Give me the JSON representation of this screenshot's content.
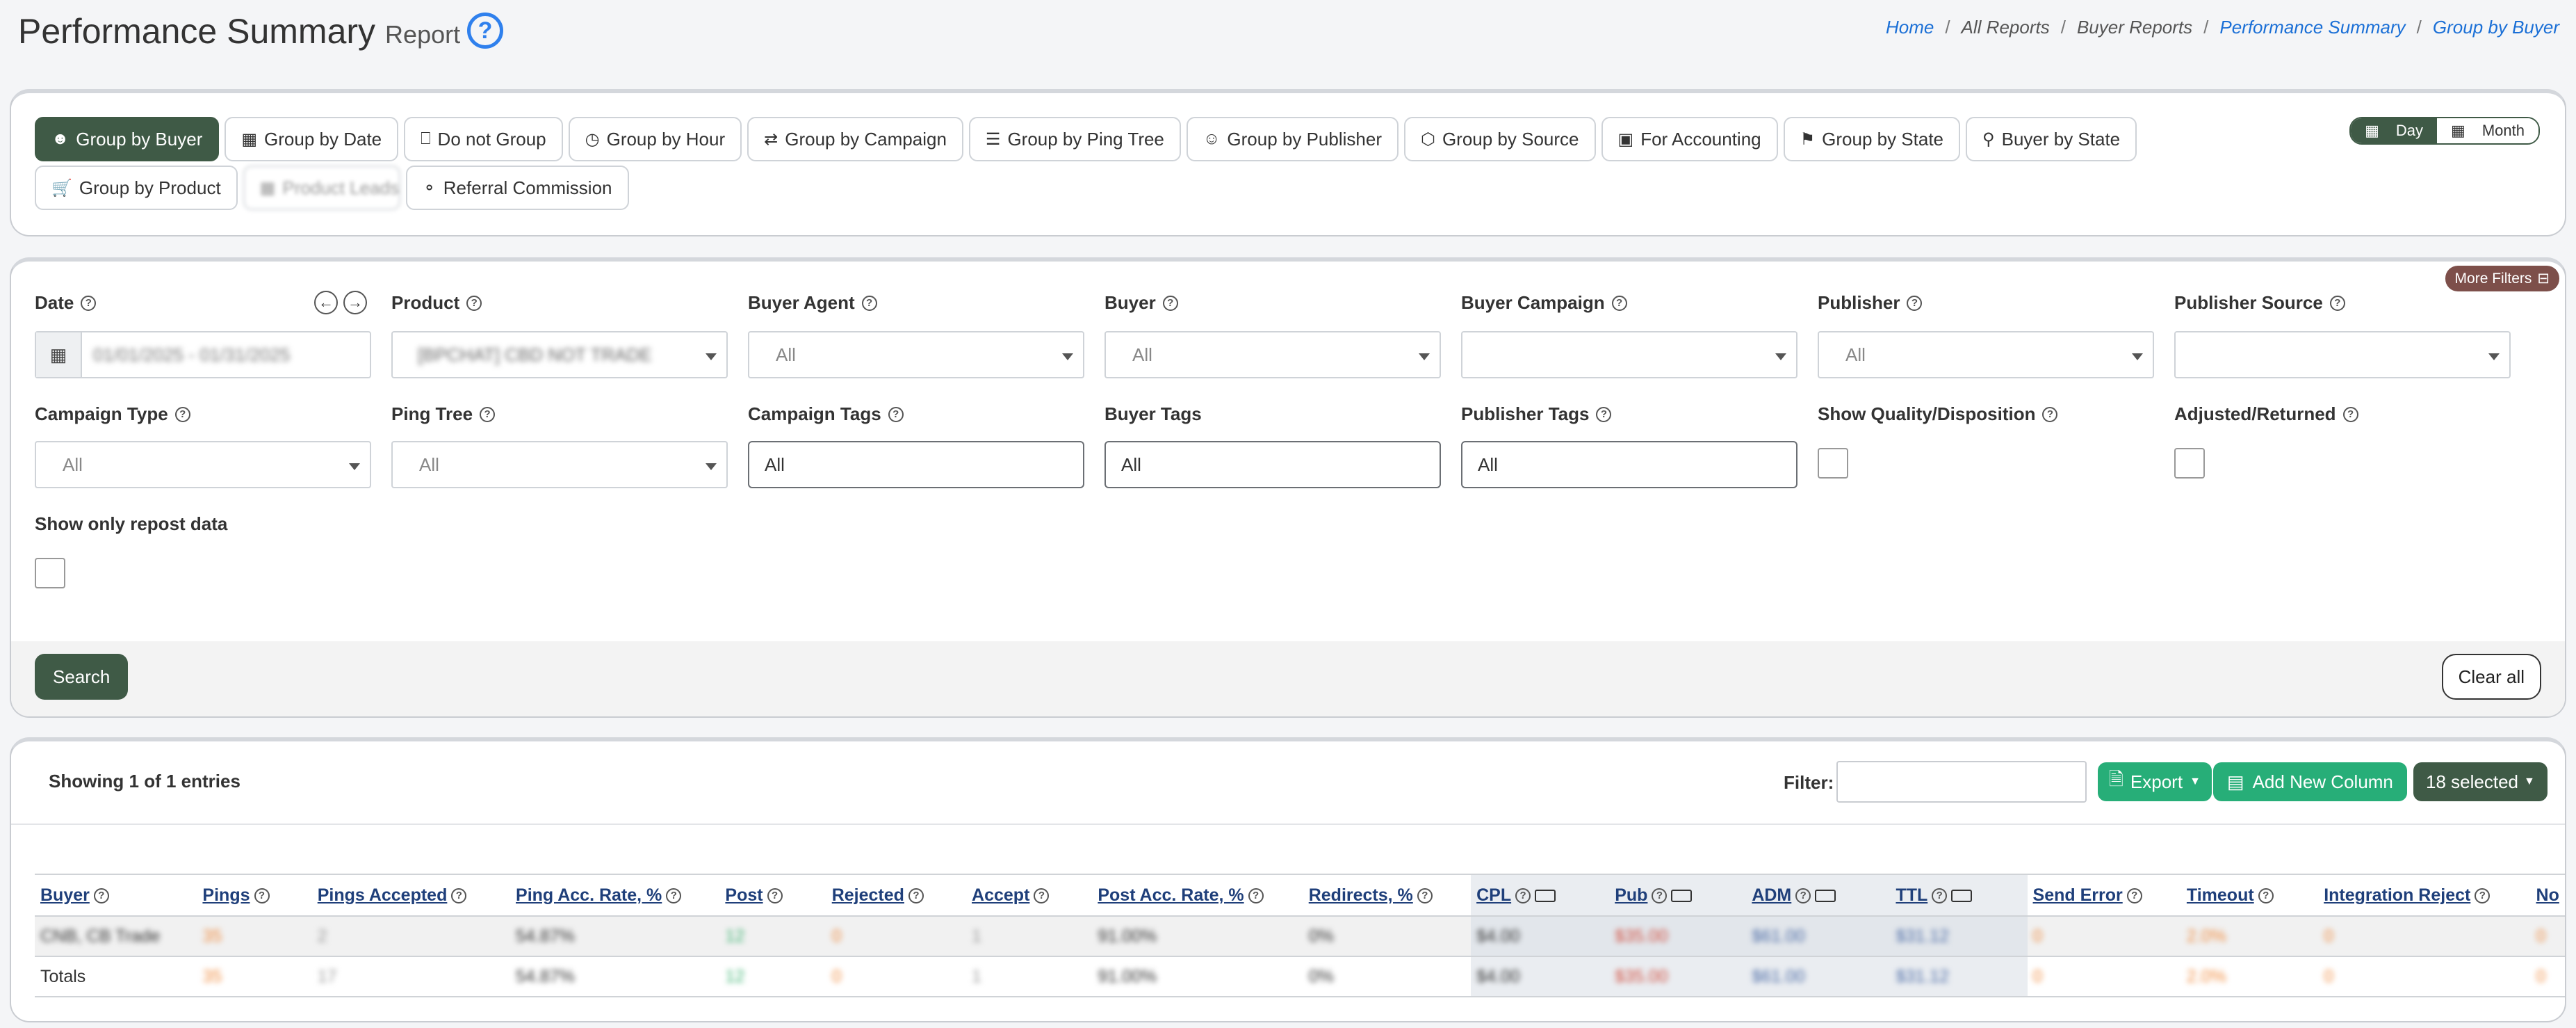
{
  "header": {
    "title": "Performance Summary",
    "subtitle": "Report",
    "help_icon": "question-circle-icon",
    "breadcrumb": [
      "Home",
      "All Reports",
      "Buyer Reports",
      "Performance Summary",
      "Group by Buyer"
    ]
  },
  "group_buttons": {
    "row1": [
      {
        "label": "Group by Buyer",
        "icon": "user-icon",
        "active": true
      },
      {
        "label": "Group by Date",
        "icon": "calendar-icon"
      },
      {
        "label": "Do not Group",
        "icon": "monitor-icon"
      },
      {
        "label": "Group by Hour",
        "icon": "clock-icon"
      },
      {
        "label": "Group by Campaign",
        "icon": "shuffle-icon"
      },
      {
        "label": "Group by Ping Tree",
        "icon": "list-icon"
      },
      {
        "label": "Group by Publisher",
        "icon": "users-icon"
      },
      {
        "label": "Group by Source",
        "icon": "box-icon"
      },
      {
        "label": "For Accounting",
        "icon": "credit-card-icon"
      },
      {
        "label": "Group by State",
        "icon": "signpost-icon"
      },
      {
        "label": "Buyer by State",
        "icon": "pin-icon"
      }
    ],
    "row2": [
      {
        "label": "Group by Product",
        "icon": "cart-icon"
      },
      {
        "label": "Product Leads",
        "icon": "grid-icon",
        "blurred": true
      },
      {
        "label": "Referral Commission",
        "icon": "piggy-bank-icon"
      }
    ],
    "period": {
      "day": "Day",
      "month": "Month",
      "selected": "Day"
    }
  },
  "filters": {
    "more_filters": "More Filters",
    "date": {
      "label": "Date",
      "value": "01/01/2025 - 01/31/2025"
    },
    "product": {
      "label": "Product",
      "value": "[BPCHAT] CBD NOT TRADE"
    },
    "buyer_agent": {
      "label": "Buyer Agent",
      "placeholder": "All"
    },
    "buyer": {
      "label": "Buyer",
      "placeholder": "All"
    },
    "buyer_campaign": {
      "label": "Buyer Campaign",
      "placeholder": ""
    },
    "publisher": {
      "label": "Publisher",
      "placeholder": "All"
    },
    "publisher_source": {
      "label": "Publisher Source",
      "placeholder": ""
    },
    "campaign_type": {
      "label": "Campaign Type",
      "placeholder": "All"
    },
    "ping_tree": {
      "label": "Ping Tree",
      "placeholder": "All"
    },
    "campaign_tags": {
      "label": "Campaign Tags",
      "value": "All"
    },
    "buyer_tags": {
      "label": "Buyer Tags",
      "value": "All"
    },
    "publisher_tags": {
      "label": "Publisher Tags",
      "value": "All"
    },
    "show_quality": {
      "label": "Show Quality/Disposition",
      "checked": false
    },
    "adjusted_returned": {
      "label": "Adjusted/Returned",
      "checked": false
    },
    "repost_only": {
      "label": "Show only repost data",
      "checked": false
    },
    "search_button": "Search",
    "clear_button": "Clear all"
  },
  "table": {
    "showing": "Showing 1 of 1 entries",
    "filter_label": "Filter:",
    "filter_value": "",
    "export_button": "Export",
    "add_column_button": "Add New Column",
    "selected_button": "18 selected",
    "columns": [
      "Buyer",
      "Pings",
      "Pings Accepted",
      "Ping Acc. Rate, %",
      "Post",
      "Rejected",
      "Accept",
      "Post Acc. Rate, %",
      "Redirects, %",
      "CPL",
      "Pub",
      "ADM",
      "TTL",
      "Send Error",
      "Timeout",
      "Integration Reject",
      "No"
    ],
    "rows": [
      {
        "buyer": "CNB, CB Trade",
        "pings": "35",
        "pings_accepted": "2",
        "ping_acc_rate": "54.87%",
        "post": "12",
        "rejected": "0",
        "accept": "1",
        "post_acc_rate": "91.00%",
        "redirects": "0%",
        "cpl": "$4.00",
        "pub": "$35.00",
        "adm": "$61.00",
        "ttl": "$31.12",
        "send_error": "0",
        "timeout": "2.0%",
        "integration_reject": "0",
        "no": "0"
      }
    ],
    "totals": {
      "label": "Totals",
      "pings": "35",
      "pings_accepted": "17",
      "ping_acc_rate": "54.87%",
      "post": "12",
      "rejected": "0",
      "accept": "1",
      "post_acc_rate": "91.00%",
      "redirects": "0%",
      "cpl": "$4.00",
      "pub": "$35.00",
      "adm": "$61.00",
      "ttl": "$31.12",
      "send_error": "0",
      "timeout": "2.0%",
      "integration_reject": "0",
      "no": "0"
    }
  }
}
